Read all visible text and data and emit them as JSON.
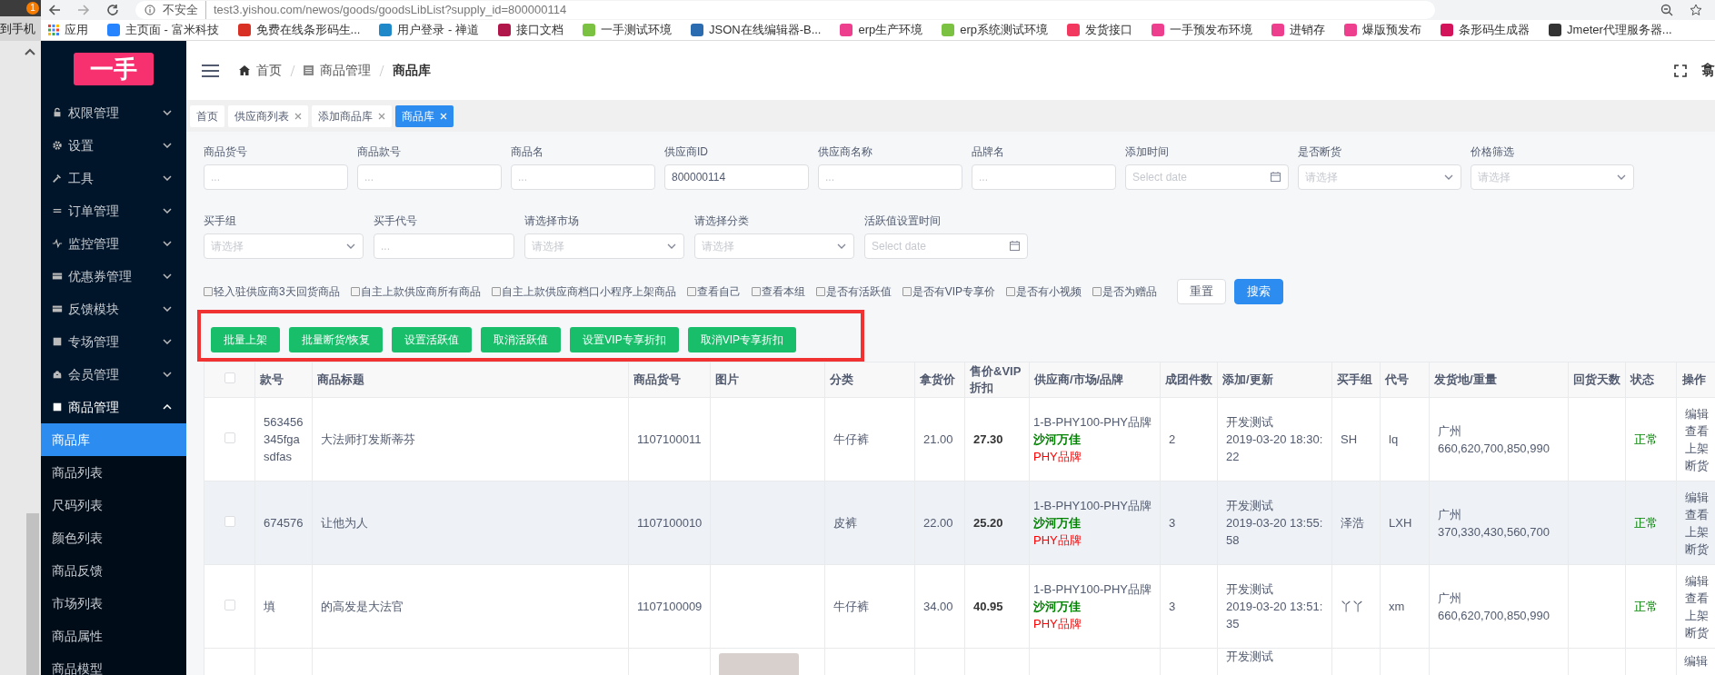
{
  "left_window": {
    "label": "到手机",
    "badge": "1"
  },
  "browser": {
    "security": "不安全",
    "url": "test3.yishou.com/newos/goods/goodsLibList?supply_id=800000114"
  },
  "bookmarks": [
    {
      "label": "应用",
      "kind": "apps"
    },
    {
      "label": "主页面 - 富米科技",
      "kind": "link",
      "color": "#2684ff"
    },
    {
      "label": "免费在线条形码生...",
      "kind": "link",
      "color": "#d93025"
    },
    {
      "label": "用户登录 - 禅道",
      "kind": "link",
      "color": "#1e88c8"
    },
    {
      "label": "接口文档",
      "kind": "link",
      "color": "#b0164a"
    },
    {
      "label": "一手测试环境",
      "kind": "link",
      "color": "#7cc242"
    },
    {
      "label": "JSON在线编辑器-B...",
      "kind": "link",
      "color": "#2b6cb0"
    },
    {
      "label": "erp生产环境",
      "kind": "link",
      "color": "#ee3f8f"
    },
    {
      "label": "erp系统测试环境",
      "kind": "link",
      "color": "#7cc242"
    },
    {
      "label": "发货接口",
      "kind": "link",
      "color": "#f2385f"
    },
    {
      "label": "一手预发布环境",
      "kind": "link",
      "color": "#ee3f8f"
    },
    {
      "label": "进销存",
      "kind": "link",
      "color": "#ee3f8f"
    },
    {
      "label": "爆版预发布",
      "kind": "link",
      "color": "#ee3f8f"
    },
    {
      "label": "条形码生成器",
      "kind": "link",
      "color": "#d4145a"
    },
    {
      "label": "Jmeter代理服务器...",
      "kind": "link",
      "color": "#333333"
    }
  ],
  "sidebar": {
    "logo": "一手",
    "items": [
      {
        "label": "权限管理",
        "expanded": false
      },
      {
        "label": "设置",
        "expanded": false
      },
      {
        "label": "工具",
        "expanded": false
      },
      {
        "label": "订单管理",
        "expanded": false
      },
      {
        "label": "监控管理",
        "expanded": false
      },
      {
        "label": "优惠券管理",
        "expanded": false
      },
      {
        "label": "反馈模块",
        "expanded": false
      },
      {
        "label": "专场管理",
        "expanded": false
      },
      {
        "label": "会员管理",
        "expanded": false
      },
      {
        "label": "商品管理",
        "expanded": true,
        "children": [
          {
            "label": "商品库",
            "selected": true
          },
          {
            "label": "商品列表",
            "selected": false
          },
          {
            "label": "尺码列表",
            "selected": false
          },
          {
            "label": "颜色列表",
            "selected": false
          },
          {
            "label": "商品反馈",
            "selected": false
          },
          {
            "label": "市场列表",
            "selected": false
          },
          {
            "label": "商品属性",
            "selected": false
          },
          {
            "label": "商品模型",
            "selected": false
          }
        ]
      }
    ]
  },
  "breadcrumb": [
    "首页",
    "商品管理",
    "商品库"
  ],
  "header_right": "翕",
  "tabs": [
    {
      "label": "首页",
      "selected": false,
      "closable": false
    },
    {
      "label": "供应商列表",
      "selected": false,
      "closable": true
    },
    {
      "label": "添加商品库",
      "selected": false,
      "closable": true
    },
    {
      "label": "商品库",
      "selected": true,
      "closable": true
    }
  ],
  "filters": [
    [
      {
        "label": "商品货号",
        "kind": "text",
        "placeholder": "..."
      },
      {
        "label": "商品款号",
        "kind": "text",
        "placeholder": "..."
      },
      {
        "label": "商品名",
        "kind": "text",
        "placeholder": "..."
      },
      {
        "label": "供应商ID",
        "kind": "text",
        "value": "800000114"
      },
      {
        "label": "供应商名称",
        "kind": "text",
        "placeholder": "..."
      },
      {
        "label": "品牌名",
        "kind": "text",
        "placeholder": "..."
      },
      {
        "label": "添加时间",
        "kind": "date",
        "placeholder": "Select date"
      },
      {
        "label": "是否断货",
        "kind": "select",
        "placeholder": "请选择"
      },
      {
        "label": "价格筛选",
        "kind": "select",
        "placeholder": "请选择"
      }
    ],
    [
      {
        "label": "买手组",
        "kind": "select",
        "placeholder": "请选择"
      },
      {
        "label": "买手代号",
        "kind": "text",
        "placeholder": "..."
      },
      {
        "label": "请选择市场",
        "kind": "select",
        "placeholder": "请选择"
      },
      {
        "label": "请选择分类",
        "kind": "select",
        "placeholder": "请选择"
      },
      {
        "label": "活跃值设置时间",
        "kind": "date",
        "placeholder": "Select date"
      }
    ]
  ],
  "options": [
    {
      "label": "轻入驻供应商3天回货商品",
      "checked": false
    },
    {
      "label": "自主上款供应商所有商品",
      "checked": false
    },
    {
      "label": "自主上款供应商档口小程序上架商品",
      "checked": false
    },
    {
      "label": "查看自己",
      "checked": false
    },
    {
      "label": "查看本组",
      "checked": false
    },
    {
      "label": "是否有活跃值",
      "checked": false
    },
    {
      "label": "是否有VIP专享价",
      "checked": false
    },
    {
      "label": "是否有小视频",
      "checked": false
    },
    {
      "label": "是否为赠品",
      "checked": false
    }
  ],
  "filter_buttons": [
    {
      "label": "重置",
      "kind": "default"
    },
    {
      "label": "搜索",
      "kind": "primary"
    }
  ],
  "actions": [
    "批量上架",
    "批量断货/恢复",
    "设置活跃值",
    "取消活跃值",
    "设置VIP专享折扣",
    "取消VIP专享折扣"
  ],
  "table": {
    "select_all_checked": false,
    "columns": [
      "款号",
      "商品标题",
      "商品货号",
      "图片",
      "分类",
      "拿货价",
      "售价&VIP折扣",
      "供应商/市场/品牌",
      "成团件数",
      "添加/更新",
      "买手组",
      "代号",
      "发货地/重量",
      "回货天数",
      "状态",
      "操作"
    ],
    "rows": [
      {
        "kind": "full",
        "checked": false,
        "highlighted": false,
        "style_no": "563456345fgasdfas",
        "title": "大法师打发斯蒂芬",
        "sku": "1107100011",
        "category": "牛仔裤",
        "cost": "21.00",
        "price": "27.30",
        "supplier": "1-B-PHY100-PHY品牌",
        "market": "沙河万佳",
        "brand": "PHY品牌",
        "group_size": "2",
        "updated_by": "开发测试",
        "updated_at": "2019-03-20 18:30:22",
        "buyer_group": "SH",
        "code": "lq",
        "ship_city": "广州",
        "weights": "660,620,700,850,990",
        "status": "正常",
        "actions": [
          "编辑",
          "查看",
          "上架",
          "断货"
        ]
      },
      {
        "kind": "full",
        "checked": false,
        "highlighted": true,
        "style_no": "674576",
        "title": "让他为人",
        "sku": "1107100010",
        "category": "皮裤",
        "cost": "22.00",
        "price": "25.20",
        "supplier": "1-B-PHY100-PHY品牌",
        "market": "沙河万佳",
        "brand": "PHY品牌",
        "group_size": "3",
        "updated_by": "开发测试",
        "updated_at": "2019-03-20 13:55:58",
        "buyer_group": "泽浩",
        "code": "LXH",
        "ship_city": "广州",
        "weights": "370,330,430,560,700",
        "status": "正常",
        "actions": [
          "编辑",
          "查看",
          "上架",
          "断货"
        ]
      },
      {
        "kind": "full",
        "checked": false,
        "highlighted": false,
        "style_no": "填",
        "title": "的高发是大法官",
        "sku": "1107100009",
        "category": "牛仔裤",
        "cost": "34.00",
        "price": "40.95",
        "supplier": "1-B-PHY100-PHY品牌",
        "market": "沙河万佳",
        "brand": "PHY品牌",
        "group_size": "3",
        "updated_by": "开发测试",
        "updated_at": "2019-03-20 13:51:35",
        "buyer_group": "丫丫",
        "code": "xm",
        "ship_city": "广州",
        "weights": "660,620,700,850,990",
        "status": "正常",
        "actions": [
          "编辑",
          "查看",
          "上架",
          "断货"
        ]
      },
      {
        "kind": "partial",
        "has_photo": true,
        "updated_by": "开发测试",
        "actions": [
          "编辑"
        ]
      }
    ]
  }
}
